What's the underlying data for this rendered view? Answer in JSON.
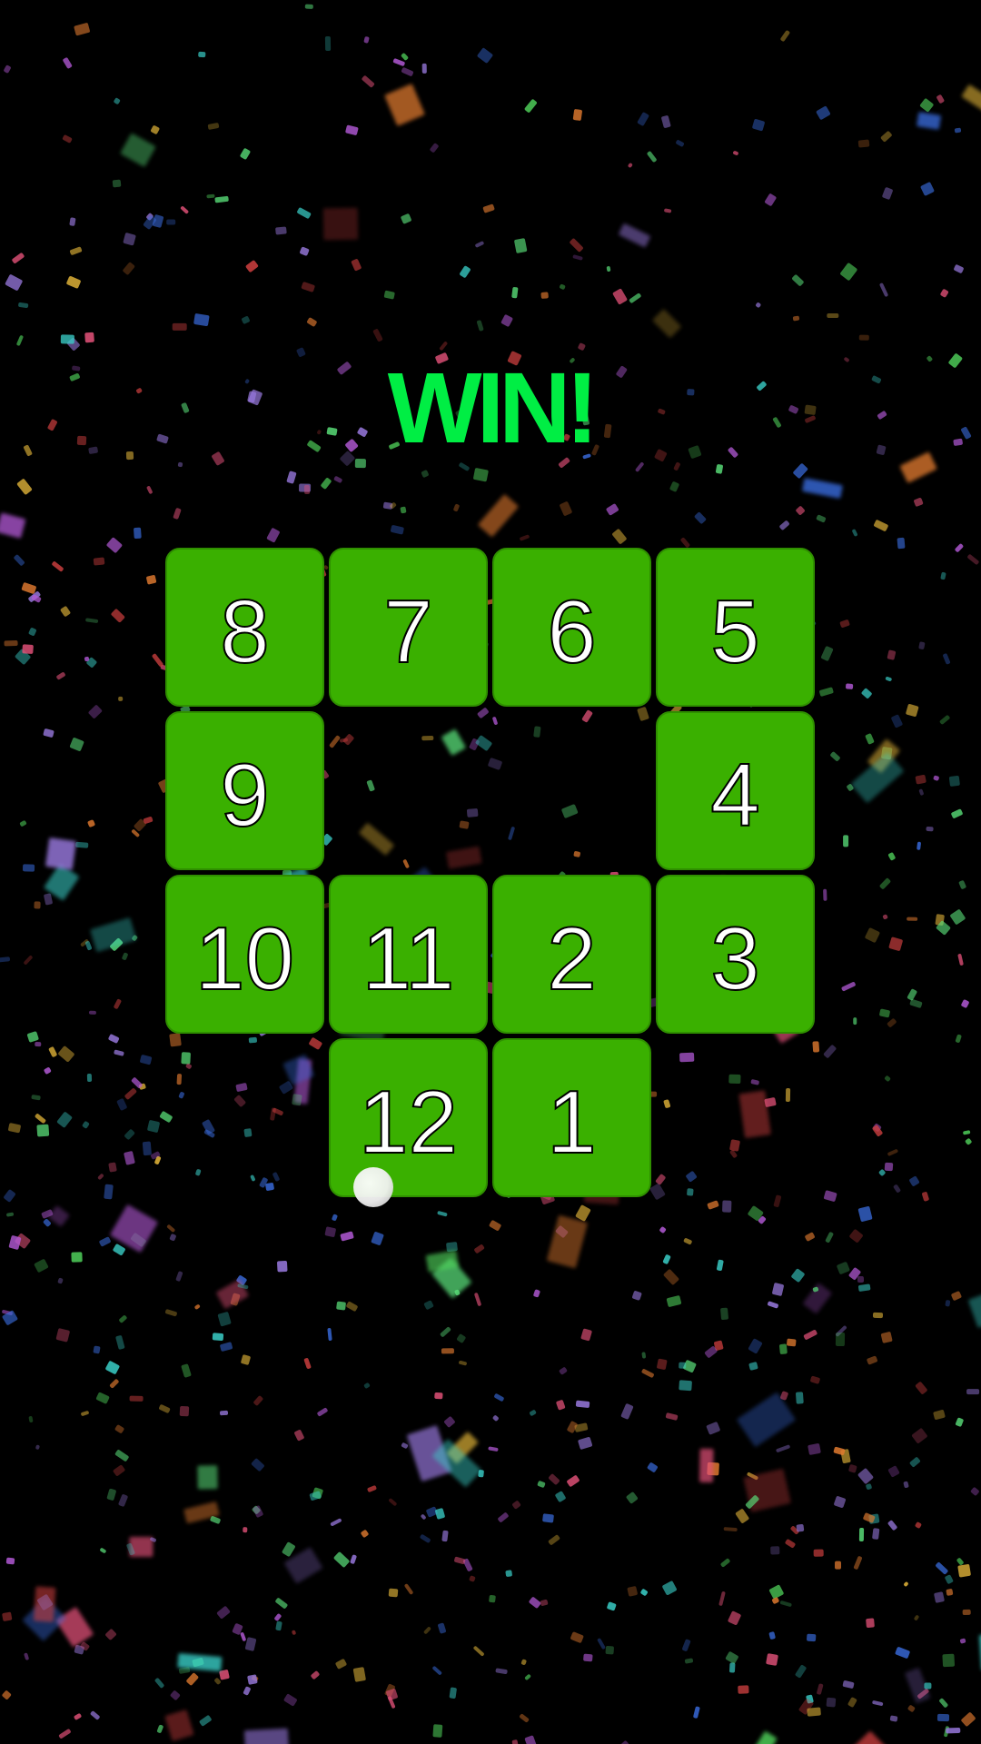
{
  "game": {
    "status_text": "WIN!",
    "status_color": "#00ee44",
    "tile_color": "#3ab000",
    "tile_border_color": "#2f8f00",
    "grid_size": 4,
    "tiles": [
      {
        "label": "8",
        "row": 0,
        "col": 0
      },
      {
        "label": "7",
        "row": 0,
        "col": 1
      },
      {
        "label": "6",
        "row": 0,
        "col": 2
      },
      {
        "label": "5",
        "row": 0,
        "col": 3
      },
      {
        "label": "9",
        "row": 1,
        "col": 0
      },
      {
        "label": "4",
        "row": 1,
        "col": 3
      },
      {
        "label": "10",
        "row": 2,
        "col": 0
      },
      {
        "label": "11",
        "row": 2,
        "col": 1
      },
      {
        "label": "2",
        "row": 2,
        "col": 2
      },
      {
        "label": "3",
        "row": 2,
        "col": 3
      },
      {
        "label": "12",
        "row": 3,
        "col": 1
      },
      {
        "label": "1",
        "row": 3,
        "col": 2
      }
    ],
    "empty_cells": [
      {
        "row": 1,
        "col": 1
      },
      {
        "row": 1,
        "col": 2
      },
      {
        "row": 3,
        "col": 0
      },
      {
        "row": 3,
        "col": 3
      }
    ]
  },
  "confetti_colors": [
    "#e5527a",
    "#4fd05a",
    "#3a6de0",
    "#e8b93a",
    "#b45ad8",
    "#3ad0c9",
    "#e07a2f",
    "#9a7ae0",
    "#d04040",
    "#5ae07a"
  ]
}
